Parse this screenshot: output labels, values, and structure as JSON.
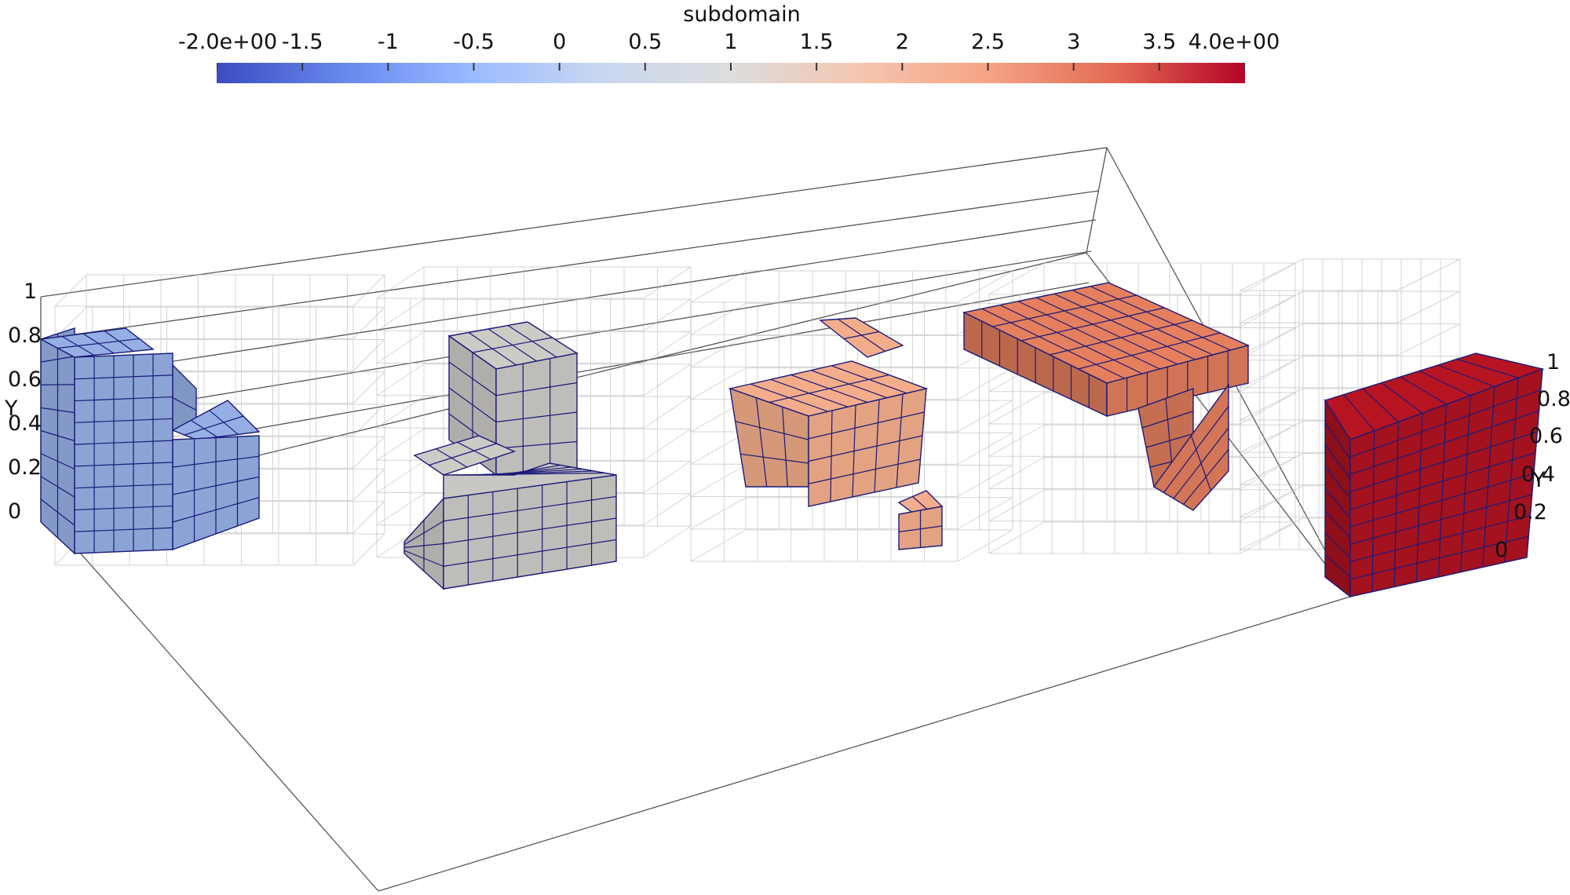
{
  "colorbar": {
    "title": "subdomain",
    "ticks": [
      "-2.0e+00",
      "-1.5",
      "-1",
      "-0.5",
      "0",
      "0.5",
      "1",
      "1.5",
      "2",
      "2.5",
      "3",
      "3.5",
      "4.0e+00"
    ],
    "range": [
      -2,
      4
    ],
    "colormap": "Cool to Warm",
    "colors": [
      "#3b4cc0",
      "#6788ee",
      "#9abbff",
      "#c9d7f0",
      "#dddddd",
      "#f4c6af",
      "#f6a385",
      "#e36a53",
      "#b40426"
    ]
  },
  "axes": {
    "left": {
      "title": "Y",
      "ticks": [
        "1",
        "0.8",
        "0.6",
        "0.4",
        "0.2",
        "0"
      ]
    },
    "right": {
      "title": "Y",
      "ticks": [
        "1",
        "0.8",
        "0.6",
        "0.4",
        "0.2",
        "0"
      ]
    }
  },
  "subdomains": [
    {
      "value": -1,
      "color": "#8ea7d9"
    },
    {
      "value": 1,
      "color": "#c3c1bd"
    },
    {
      "value": 2,
      "color": "#e8a584"
    },
    {
      "value": 3,
      "color": "#dc7a5a"
    },
    {
      "value": 4,
      "color": "#a6121f"
    }
  ],
  "grid_color": "#b0b0b0",
  "edge_color": "#1a1a7a"
}
